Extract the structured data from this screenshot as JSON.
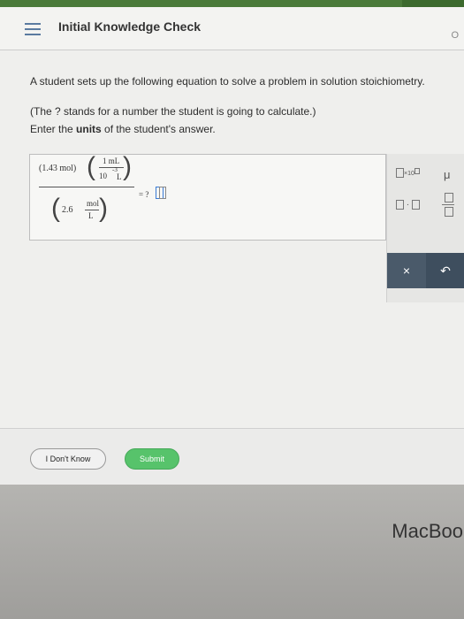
{
  "app": {
    "title": "Initial Knowledge Check"
  },
  "prompt": {
    "line1": "A student sets up the following equation to solve a problem in solution stoichiometry.",
    "line2": "(The ? stands for a number the student is going to calculate.)",
    "line3_prefix": "Enter the ",
    "line3_bold": "units",
    "line3_suffix": " of the student's answer."
  },
  "equation": {
    "mol_amount": "(1.43 mol)",
    "mL_num": "1 mL",
    "ten": "10",
    "exp": "-3",
    "L": "L",
    "denominator_coeff": "2.6",
    "den_unit_top": "mol",
    "den_unit_bottom": "L",
    "equals": "= ?"
  },
  "tools": {
    "sci_notation": "×10",
    "mu": "μ",
    "dot": "·",
    "clear": "×",
    "undo": "↶"
  },
  "buttons": {
    "dont_know": "I Don't Know",
    "submit": "Submit"
  },
  "device": {
    "brand": "MacBook"
  }
}
